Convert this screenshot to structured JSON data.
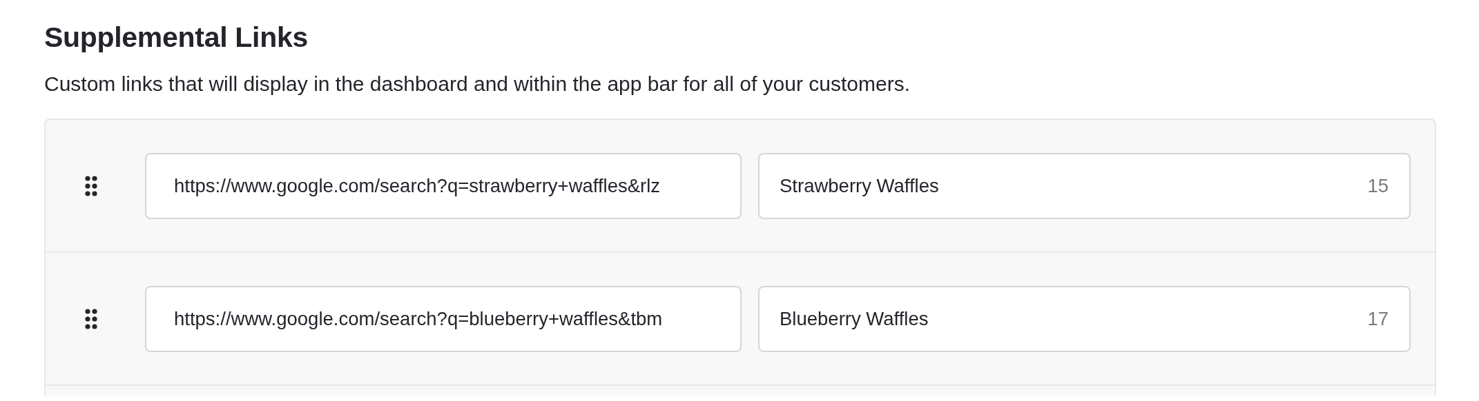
{
  "section": {
    "title": "Supplemental Links",
    "description": "Custom links that will display in the dashboard and within the app bar for all of your customers."
  },
  "links": [
    {
      "url": "https://www.google.com/search?q=strawberry+waffles&rlz",
      "name": "Strawberry Waffles",
      "count": "15"
    },
    {
      "url": "https://www.google.com/search?q=blueberry+waffles&tbm",
      "name": "Blueberry Waffles",
      "count": "17"
    }
  ]
}
